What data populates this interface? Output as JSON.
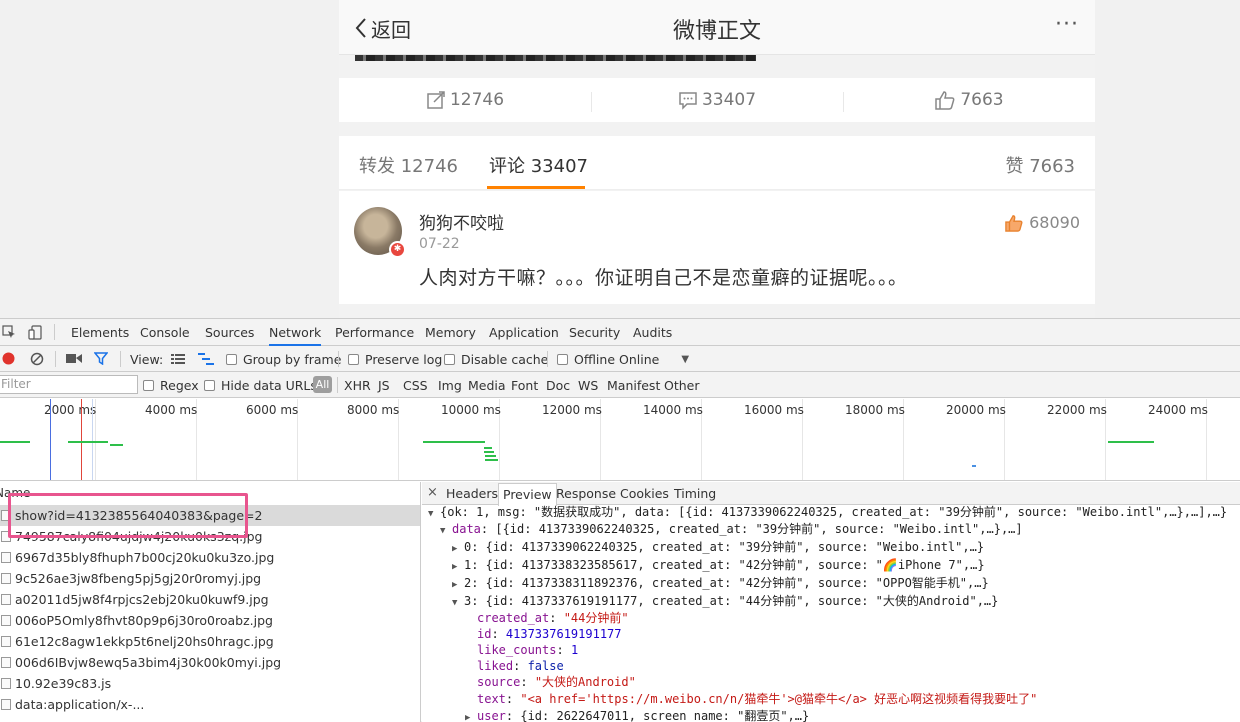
{
  "weibo": {
    "nav": {
      "back_label": "返回",
      "title": "微博正文",
      "more": "···"
    },
    "actions": {
      "repost_count": "12746",
      "comment_count": "33407",
      "like_count": "7663"
    },
    "tabs": {
      "repost": "转发 12746",
      "comment": "评论 33407",
      "like": "赞 7663"
    },
    "comment": {
      "username": "狗狗不咬啦",
      "date": "07-22",
      "text": "人肉对方干嘛？。。。你证明自己不是恋童癖的证据呢。。。",
      "likes": "68090"
    },
    "accent_color": "#ff8200"
  },
  "devtools": {
    "tabs": [
      "Elements",
      "Console",
      "Sources",
      "Network",
      "Performance",
      "Memory",
      "Application",
      "Security",
      "Audits"
    ],
    "active_tab": "Network",
    "toolbar": {
      "view_label": "View:",
      "group_by_frame": "Group by frame",
      "preserve_log": "Preserve log",
      "disable_cache": "Disable cache",
      "offline": "Offline",
      "throttle": "Online"
    },
    "filter": {
      "placeholder": "Filter",
      "regex": "Regex",
      "hide_data_urls": "Hide data URLs",
      "types": [
        "All",
        "XHR",
        "JS",
        "CSS",
        "Img",
        "Media",
        "Font",
        "Doc",
        "WS",
        "Manifest",
        "Other"
      ]
    },
    "timeline": {
      "ticks": [
        "2000 ms",
        "4000 ms",
        "6000 ms",
        "8000 ms",
        "10000 ms",
        "12000 ms",
        "14000 ms",
        "16000 ms",
        "18000 ms",
        "20000 ms",
        "22000 ms",
        "24000 ms"
      ]
    },
    "requests": {
      "header": "Name",
      "rows": [
        "show?id=4132385564040383&page=2",
        "749587caly8fi04ujdjw4j20ku0ks3zq.jpg",
        "6967d35bly8fhuph7b00cj20ku0ku3zo.jpg",
        "9c526ae3jw8fbeng5pj5gj20r0romyj.jpg",
        "a02011d5jw8f4rpjcs2ebj20ku0kuwf9.jpg",
        "006oP5Omly8fhvt80p9p6j30ro0roabz.jpg",
        "61e12c8agw1ekkp5t6nelj20hs0hragc.jpg",
        "006d6IBvjw8ewq5a3bim4j30k00k0myi.jpg",
        "10.92e39c83.js",
        "data:application/x-..."
      ]
    },
    "preview": {
      "tabs": [
        "Headers",
        "Preview",
        "Response",
        "Cookies",
        "Timing"
      ],
      "active_tab": "Preview",
      "close": "×",
      "lines": {
        "root": "{ok: 1, msg: \"数据获取成功\", data: [{id: 4137339062240325, created_at: \"39分钟前\", source: \"Weibo.intl\",…},…],…}",
        "data_key": "data",
        "data_summary": ": [{id: 4137339062240325, created_at: \"39分钟前\", source: \"Weibo.intl\",…},…]",
        "item0": "0: {id: 4137339062240325, created_at: \"39分钟前\", source: \"Weibo.intl\",…}",
        "item1": "1: {id: 4137338323585617, created_at: \"42分钟前\", source: \"🌈iPhone 7\",…}",
        "item2": "2: {id: 4137338311892376, created_at: \"42分钟前\", source: \"OPPO智能手机\",…}",
        "item3": "3: {id: 4137337619191177, created_at: \"44分钟前\", source: \"大侠的Android\",…}",
        "created_at_key": "created_at",
        "created_at_val": "\"44分钟前\"",
        "id_key": "id",
        "id_val": "4137337619191177",
        "like_counts_key": "like_counts",
        "like_counts_val": "1",
        "liked_key": "liked",
        "liked_val": "false",
        "source_key": "source",
        "source_val": "\"大侠的Android\"",
        "text_key": "text",
        "text_val": "\"<a href='https://m.weibo.cn/n/猫牵牛'>@猫牵牛</a>  好恶心啊这视频看得我要吐了\"",
        "user_key": "user",
        "user_val": ": {id: 2622647011, screen_name: \"翻壹页\",…}"
      }
    },
    "accent_color": "#1a73e8",
    "highlight_color": "#e8558e"
  }
}
